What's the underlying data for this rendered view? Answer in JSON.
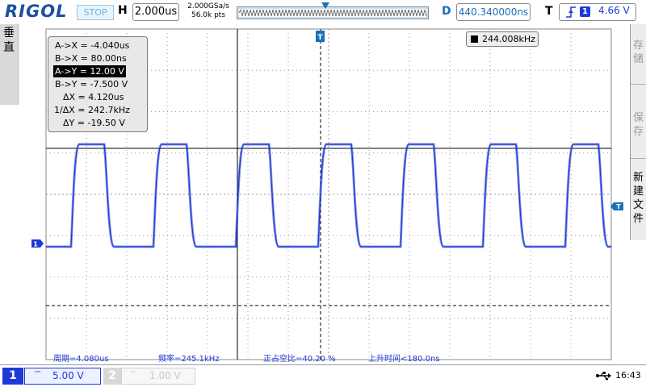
{
  "header": {
    "brand": "RIGOL",
    "run_state": "STOP",
    "horizontal_label": "H",
    "timebase": "2.000us",
    "sample_rate": "2.000GSa/s",
    "memory_depth": "56.0k pts",
    "delay_label": "D",
    "delay": "440.340000ns",
    "trigger_label": "T",
    "trigger_source": "1",
    "trigger_level": "4.66 V"
  },
  "left_tab": {
    "label": "垂直"
  },
  "right_menu": {
    "items": [
      {
        "label": "存储",
        "active": false
      },
      {
        "label": "保存",
        "active": false
      },
      {
        "label": "新建文件",
        "active": true
      }
    ]
  },
  "cursor_readout": {
    "rows": [
      {
        "label": "A->X",
        "value": "-4.040us"
      },
      {
        "label": "B->X",
        "value": "80.00ns"
      },
      {
        "label": "A->Y",
        "value": "12.00 V",
        "selected": true
      },
      {
        "label": "B->Y",
        "value": "-7.500 V"
      },
      {
        "label": "ΔX",
        "value": "4.120us"
      },
      {
        "label": "1/ΔX",
        "value": "242.7kHz"
      },
      {
        "label": "ΔY",
        "value": "-19.50 V"
      }
    ]
  },
  "frequency_counter": {
    "value": "244.008kHz"
  },
  "measurements": {
    "period": "周期=4.080us",
    "frequency": "频率=245.1kHz",
    "duty": "正占空比=40.20 %",
    "rise_time": "上升时间<180.0ns"
  },
  "channels": [
    {
      "number": "1",
      "coupling": "DC",
      "scale": "5.00 V",
      "active": true,
      "color": "#1e3ad6"
    },
    {
      "number": "2",
      "coupling": "DC",
      "scale": "1.00 V",
      "active": false,
      "color": "#c8c8c8"
    }
  ],
  "markers": {
    "channel1": "1",
    "trigger": "T"
  },
  "status": {
    "time": "16:43"
  },
  "colors": {
    "brand": "#1b4fa0",
    "ch1": "#1e3ad6",
    "accent": "#1d6fb8"
  },
  "waveform": {
    "shape": "square",
    "period_us": 4.08,
    "duty_percent": 40.2,
    "rise_time_ns": 180.0
  }
}
